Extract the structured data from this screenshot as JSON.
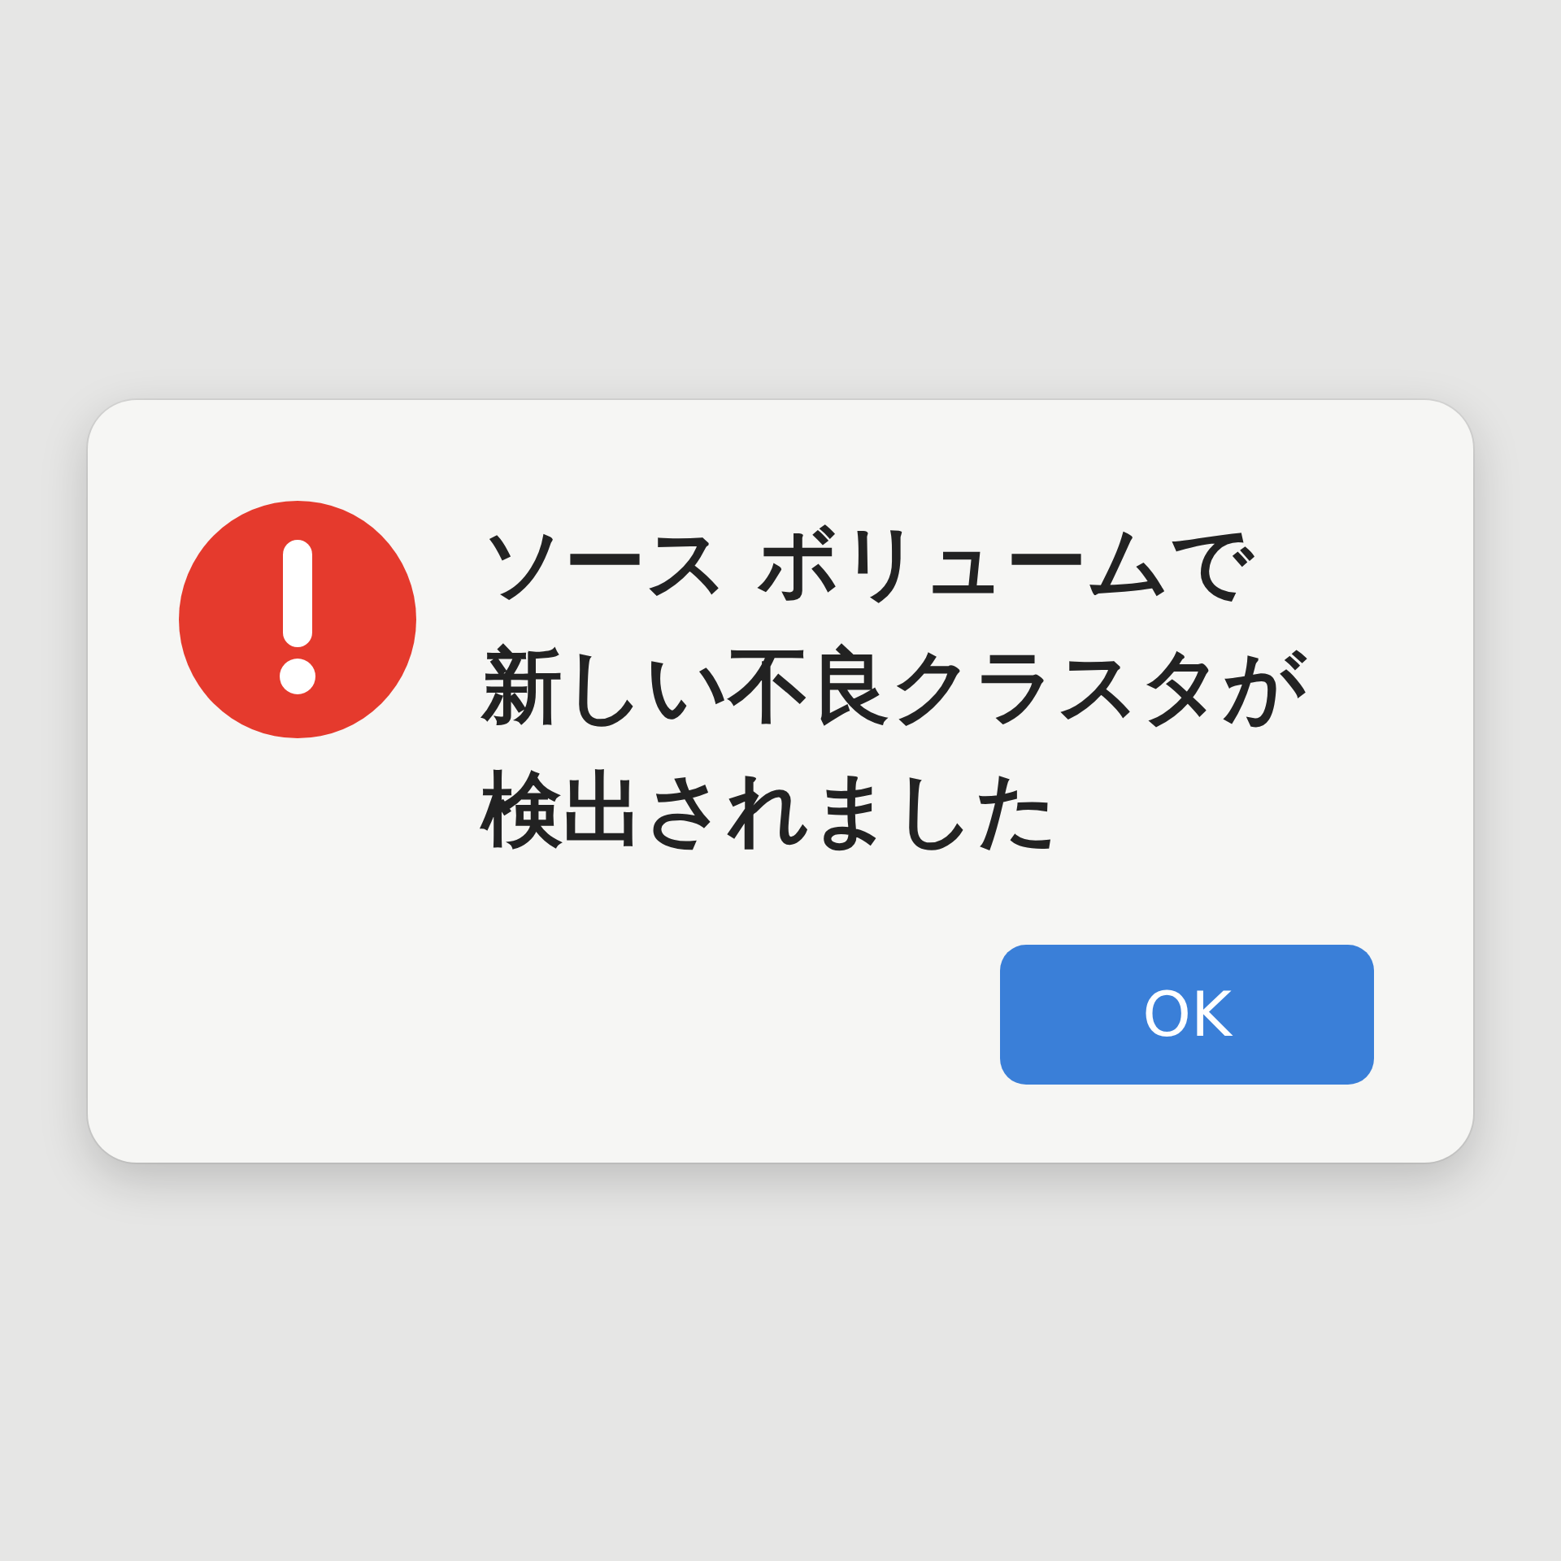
{
  "dialog": {
    "message_lines": [
      "ソース ボリュームで",
      "新しい不良クラスタが",
      "検出されました"
    ],
    "buttons": [
      {
        "label": "OK",
        "default": true
      }
    ]
  }
}
